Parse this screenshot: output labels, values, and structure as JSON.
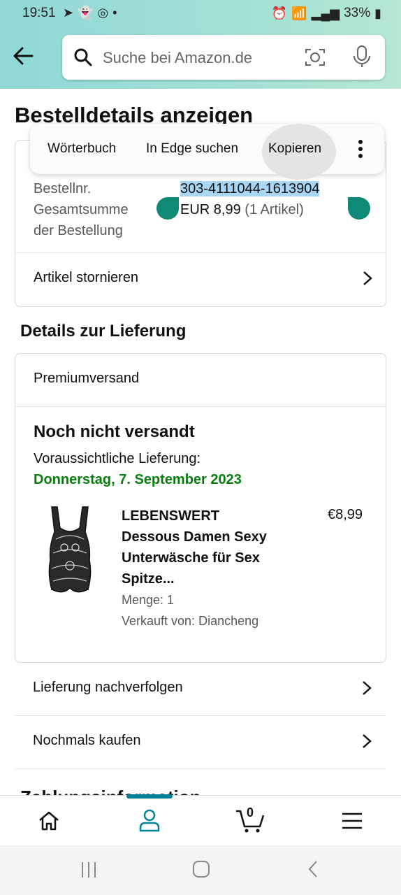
{
  "status_bar": {
    "time": "19:51",
    "battery": "33%"
  },
  "search": {
    "placeholder": "Suche bei Amazon.de"
  },
  "page": {
    "title": "Bestelldetails anzeigen"
  },
  "context_menu": {
    "items": [
      "Wörterbuch",
      "In Edge suchen",
      "Kopieren"
    ]
  },
  "order": {
    "number_label": "Bestellnr.",
    "number_value": "303-4111044-1613904",
    "total_label_line1": "Gesamtsumme",
    "total_label_line2": "der Bestellung",
    "total_value": "EUR 8,99",
    "total_items": "(1 Artikel)",
    "cancel_label": "Artikel stornieren"
  },
  "delivery": {
    "section_title": "Details zur Lieferung",
    "shipping_method": "Premiumversand",
    "status": "Noch nicht versandt",
    "expected_label": "Voraussichtliche Lieferung:",
    "expected_date": "Donnerstag, 7. September 2023",
    "product": {
      "title_line1": "LEBENSWERT",
      "title_line2": "Dessous Damen Sexy",
      "title_line3": "Unterwäsche für Sex",
      "title_line4": "Spitze...",
      "price": "€8,99",
      "quantity": "Menge: 1",
      "seller": "Verkauft von: Diancheng"
    }
  },
  "actions": {
    "track": "Lieferung nachverfolgen",
    "buy_again": "Nochmals kaufen"
  },
  "payment": {
    "section_title": "Zahlungsinformation"
  },
  "bottom_nav": {
    "cart_count": "0"
  }
}
